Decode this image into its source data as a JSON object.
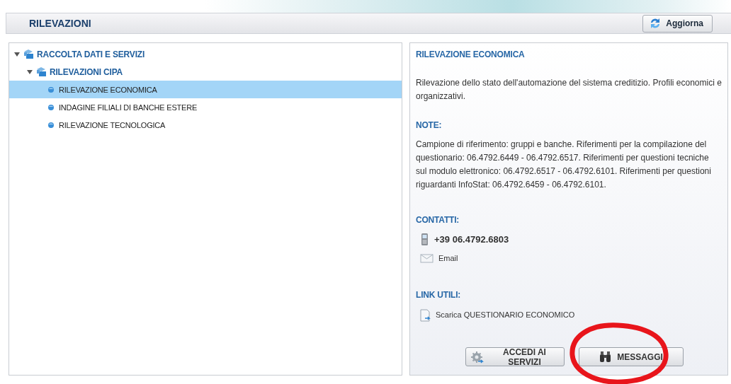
{
  "header": {
    "title": "RILEVAZIONI",
    "refresh_button": "Aggiorna"
  },
  "tree": [
    {
      "label": "RACCOLTA DATI E SERVIZI",
      "expanded": true,
      "selected": false,
      "children": [
        {
          "label": "RILEVAZIONI CIPA",
          "expanded": true,
          "selected": false,
          "children": [
            {
              "label": "RILEVAZIONE ECONOMICA",
              "selected": true
            },
            {
              "label": "INDAGINE FILIALI DI BANCHE ESTERE",
              "selected": false
            },
            {
              "label": "RILEVAZIONE TECNOLOGICA",
              "selected": false
            }
          ]
        }
      ]
    }
  ],
  "detail": {
    "title": "RILEVAZIONE ECONOMICA",
    "description": "Rilevazione dello stato dell'automazione del sistema creditizio. Profili economici e organizzativi.",
    "notes_heading": "NOTE:",
    "notes": "Campione di riferimento: gruppi e banche. Riferimenti per la compilazione del questionario: 06.4792.6449 - 06.4792.6517. Riferimenti per questioni tecniche sul modulo elettronico: 06.4792.6517 - 06.4792.6101. Riferimenti per questioni riguardanti InfoStat: 06.4792.6459 - 06.4792.6101.",
    "contacts_heading": "CONTATTI:",
    "contacts": [
      {
        "kind": "phone",
        "text": "+39 06.4792.6803"
      },
      {
        "kind": "email",
        "text": "Email"
      }
    ],
    "links_heading": "LINK UTILI:",
    "links": [
      {
        "text": "Scarica QUESTIONARIO ECONOMICO"
      }
    ],
    "buttons": [
      {
        "kind": "services",
        "label": "ACCEDI AI SERVIZI"
      },
      {
        "kind": "messages",
        "label": "MESSAGGI"
      }
    ]
  }
}
